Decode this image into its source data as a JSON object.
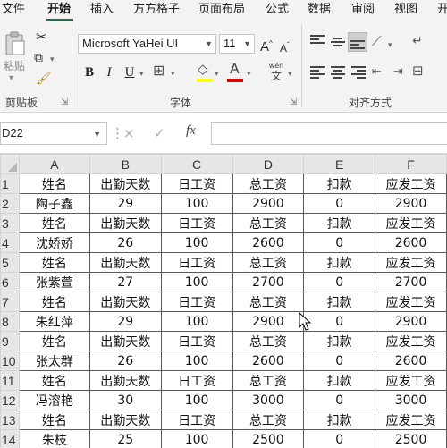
{
  "ribbon_tabs": [
    {
      "label": "文件",
      "active": false
    },
    {
      "label": "开始",
      "active": true
    },
    {
      "label": "插入",
      "active": false
    },
    {
      "label": "方方格子",
      "active": false
    },
    {
      "label": "页面布局",
      "active": false
    },
    {
      "label": "公式",
      "active": false
    },
    {
      "label": "数据",
      "active": false
    },
    {
      "label": "审阅",
      "active": false
    },
    {
      "label": "视图",
      "active": false
    },
    {
      "label": "开",
      "active": false
    }
  ],
  "ribbon": {
    "paste_label": "粘贴",
    "clipboard_label": "剪贴板",
    "font_group_label": "字体",
    "align_group_label": "对齐方式",
    "font_name": "Microsoft YaHei UI",
    "font_size": "11",
    "grow_font": "A",
    "shrink_font": "A",
    "bold": "B",
    "italic": "I",
    "underline": "U",
    "font_color_letter": "A",
    "phonetic_top": "wén",
    "phonetic_bottom": "文",
    "fill_color": "#ffff00",
    "font_color": "#e00000"
  },
  "formula_bar": {
    "name_box": "D22",
    "cancel_icon": "×",
    "enter_icon": "✓",
    "fx_label": "fx",
    "formula": ""
  },
  "sheet": {
    "column_headers": [
      "A",
      "B",
      "C",
      "D",
      "E",
      "F"
    ],
    "row_headers": [
      "1",
      "2",
      "3",
      "4",
      "5",
      "6",
      "7",
      "8",
      "9",
      "10",
      "11",
      "12",
      "13",
      "14"
    ],
    "rows": [
      [
        "姓名",
        "出勤天数",
        "日工资",
        "总工资",
        "扣款",
        "应发工资"
      ],
      [
        "陶子鑫",
        "29",
        "100",
        "2900",
        "0",
        "2900"
      ],
      [
        "姓名",
        "出勤天数",
        "日工资",
        "总工资",
        "扣款",
        "应发工资"
      ],
      [
        "沈娇娇",
        "26",
        "100",
        "2600",
        "0",
        "2600"
      ],
      [
        "姓名",
        "出勤天数",
        "日工资",
        "总工资",
        "扣款",
        "应发工资"
      ],
      [
        "张紫萱",
        "27",
        "100",
        "2700",
        "0",
        "2700"
      ],
      [
        "姓名",
        "出勤天数",
        "日工资",
        "总工资",
        "扣款",
        "应发工资"
      ],
      [
        "朱红萍",
        "29",
        "100",
        "2900",
        "0",
        "2900"
      ],
      [
        "姓名",
        "出勤天数",
        "日工资",
        "总工资",
        "扣款",
        "应发工资"
      ],
      [
        "张太群",
        "26",
        "100",
        "2600",
        "0",
        "2600"
      ],
      [
        "姓名",
        "出勤天数",
        "日工资",
        "总工资",
        "扣款",
        "应发工资"
      ],
      [
        "冯溶艳",
        "30",
        "100",
        "3000",
        "0",
        "3000"
      ],
      [
        "姓名",
        "出勤天数",
        "日工资",
        "总工资",
        "扣款",
        "应发工资"
      ],
      [
        "朱枝",
        "25",
        "100",
        "2500",
        "0",
        "2500"
      ]
    ]
  },
  "colors": {
    "accent": "#217346",
    "grid_line": "#d4d4d4",
    "cell_border": "#5a5a5a",
    "header_bg": "#e6e6e6"
  }
}
